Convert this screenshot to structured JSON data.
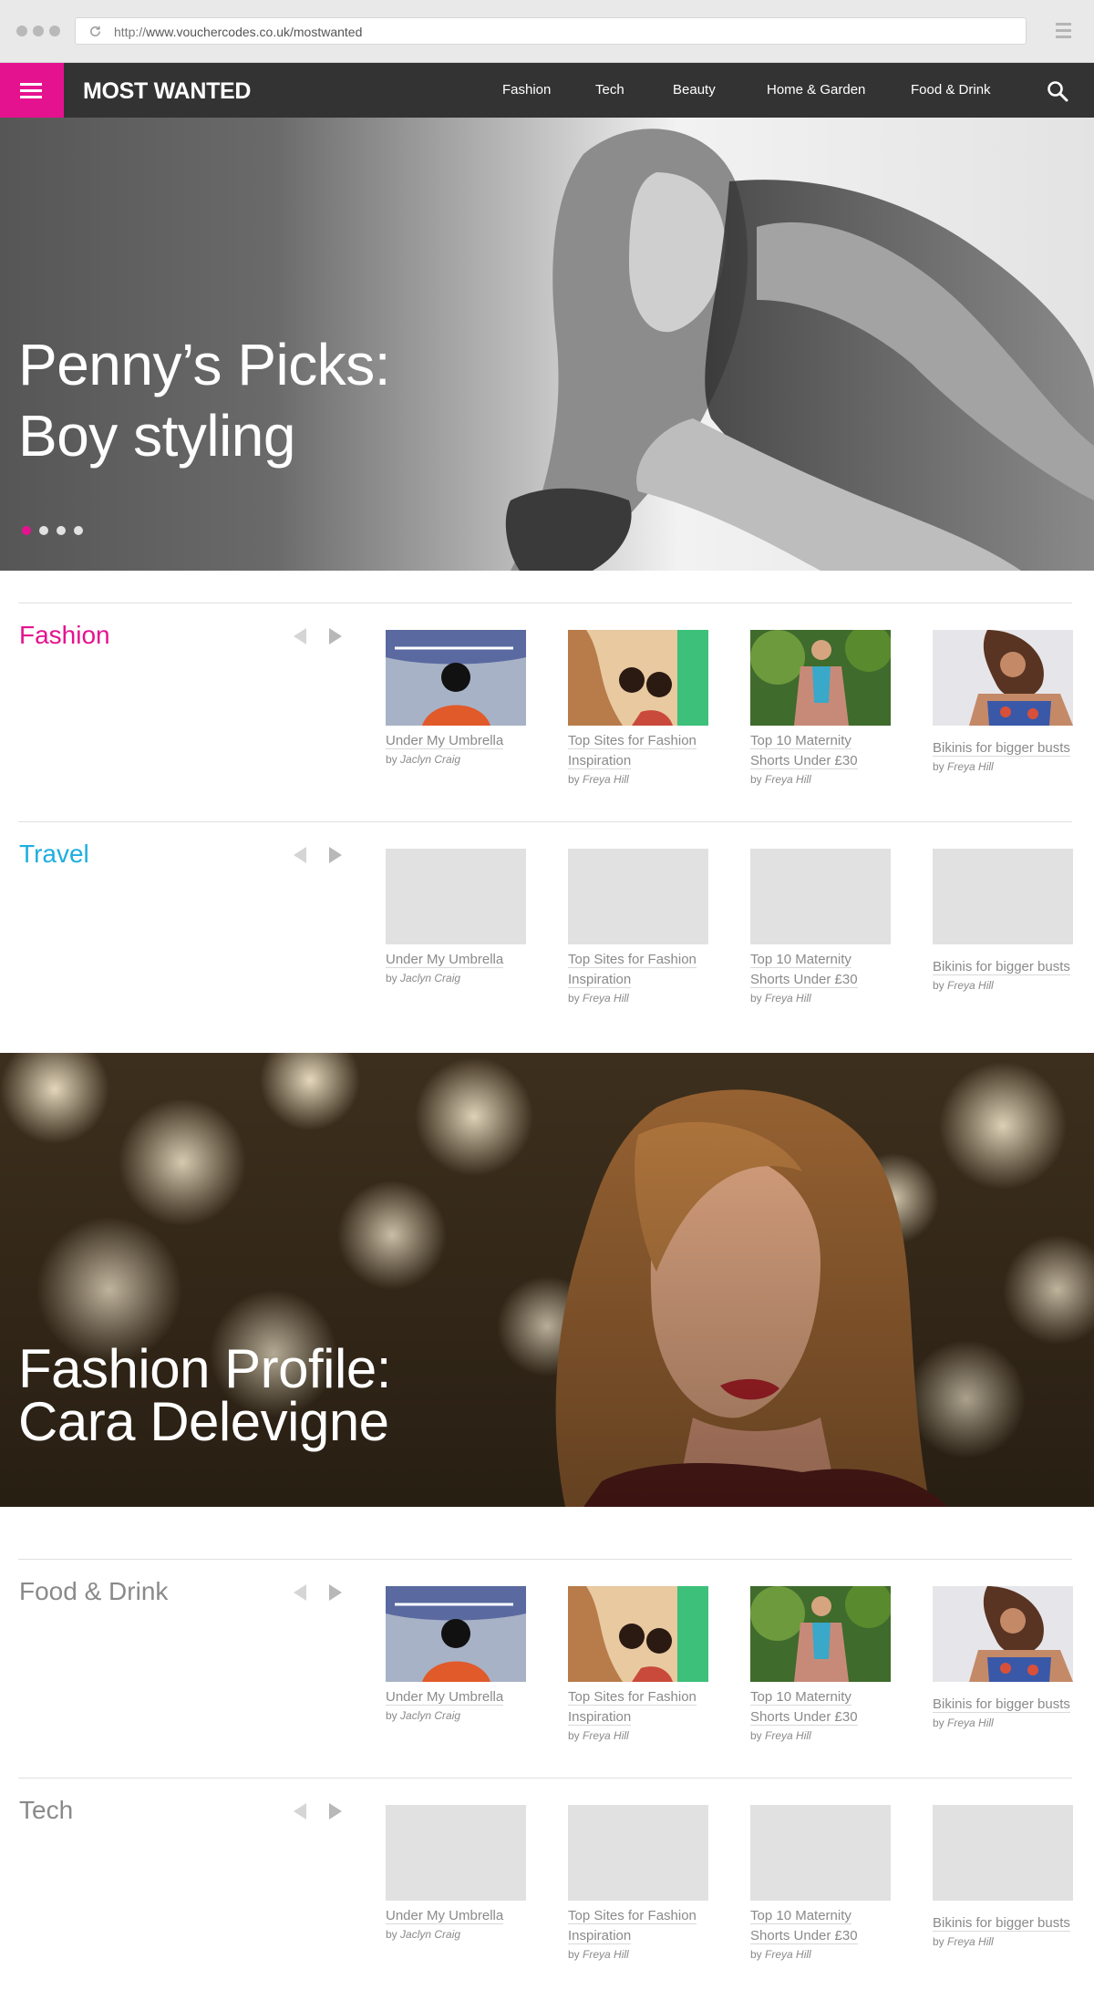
{
  "browser": {
    "url_prefix": "http://",
    "url_host": "www.vouchercodes.co.uk/mostwanted"
  },
  "nav": {
    "logo": "MOST WANTED",
    "links": [
      "Fashion",
      "Tech",
      "Beauty",
      "Home & Garden",
      "Food & Drink"
    ],
    "accent": "#e5128f"
  },
  "hero1": {
    "line1": "Penny’s Picks:",
    "line2": "Boy styling",
    "slide_count": 4,
    "active_slide": 1
  },
  "hero2": {
    "line1": "Fashion Profile:",
    "line2": "Cara Delevigne"
  },
  "sections": [
    {
      "title": "Fashion",
      "color": "#e5128f",
      "cards": [
        {
          "title": "Under My Umbrella",
          "by": "by",
          "author": "Jaclyn Craig"
        },
        {
          "title": "Top Sites for Fashion Inspiration",
          "by": "by",
          "author": "Freya Hill"
        },
        {
          "title": "Top 10 Maternity Shorts Under £30",
          "by": "by",
          "author": "Freya Hill"
        },
        {
          "title": "Bikinis for bigger busts",
          "by": "by",
          "author": "Freya Hill"
        }
      ]
    },
    {
      "title": "Travel",
      "color": "#1eaee0",
      "cards": [
        {
          "title": "Under My Umbrella",
          "by": "by",
          "author": "Jaclyn Craig"
        },
        {
          "title": "Top Sites for Fashion Inspiration",
          "by": "by",
          "author": "Freya Hill"
        },
        {
          "title": "Top 10 Maternity Shorts Under £30",
          "by": "by",
          "author": "Freya Hill"
        },
        {
          "title": "Bikinis for bigger busts",
          "by": "by",
          "author": "Freya Hill"
        }
      ]
    },
    {
      "title": "Food & Drink",
      "color": "#8a8a8a",
      "cards": [
        {
          "title": "Under My Umbrella",
          "by": "by",
          "author": "Jaclyn Craig"
        },
        {
          "title": "Top Sites for Fashion Inspiration",
          "by": "by",
          "author": "Freya Hill"
        },
        {
          "title": "Top 10 Maternity Shorts Under £30",
          "by": "by",
          "author": "Freya Hill"
        },
        {
          "title": "Bikinis for bigger busts",
          "by": "by",
          "author": "Freya Hill"
        }
      ]
    },
    {
      "title": "Tech",
      "color": "#8a8a8a",
      "cards": [
        {
          "title": "Under My Umbrella",
          "by": "by",
          "author": "Jaclyn Craig"
        },
        {
          "title": "Top Sites for Fashion Inspiration",
          "by": "by",
          "author": "Freya Hill"
        },
        {
          "title": "Top 10 Maternity Shorts Under £30",
          "by": "by",
          "author": "Freya Hill"
        },
        {
          "title": "Bikinis for bigger busts",
          "by": "by",
          "author": "Freya Hill"
        }
      ]
    }
  ]
}
